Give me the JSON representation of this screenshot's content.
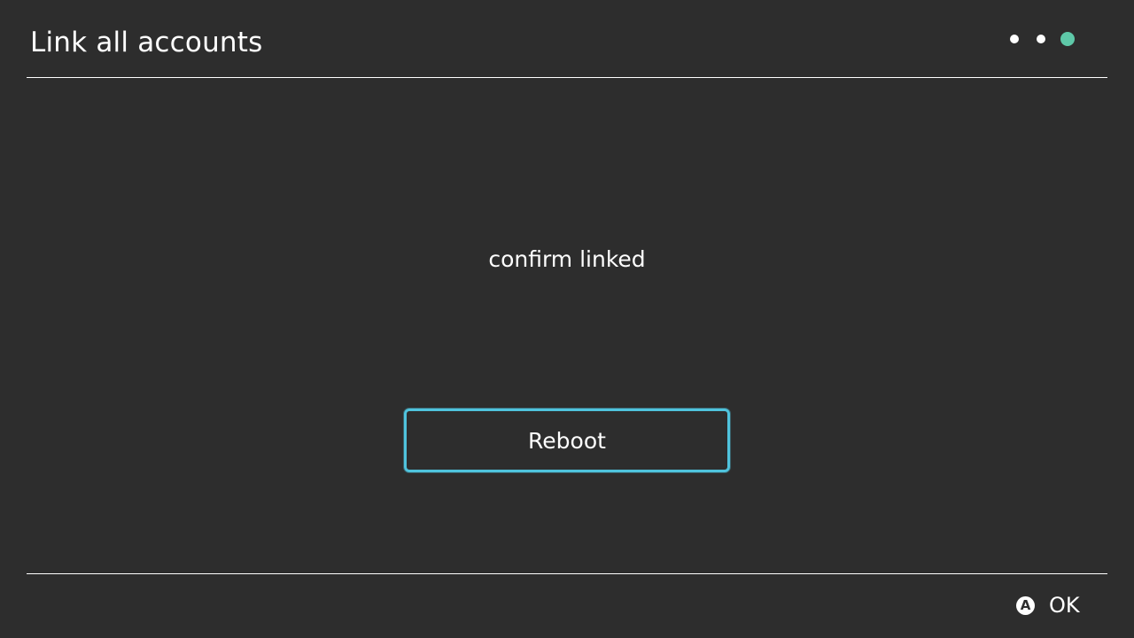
{
  "header": {
    "title": "Link all accounts",
    "step_indicator": {
      "total": 3,
      "current": 3,
      "inactive_color": "#ffffff",
      "active_color": "#5ec8a8"
    }
  },
  "main": {
    "message": "confirm linked",
    "button_label": "Reboot",
    "focus_color": "#4fc3dd"
  },
  "footer": {
    "action_icon_glyph": "A",
    "action_icon": "a-button-icon",
    "action_label": "OK"
  }
}
